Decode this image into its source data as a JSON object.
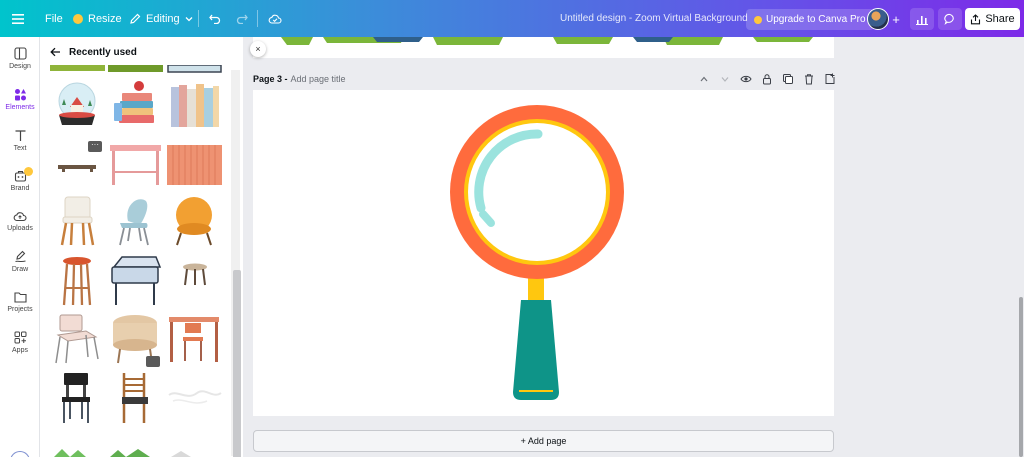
{
  "topbar": {
    "file_label": "File",
    "resize_label": "Resize",
    "editing_label": "Editing",
    "doc_title": "Untitled design - Zoom Virtual Background",
    "upgrade_label": "Upgrade to Canva Pro",
    "share_label": "Share",
    "add_member": "+"
  },
  "rail": {
    "items": [
      {
        "label": "Design",
        "icon": "design-icon"
      },
      {
        "label": "Elements",
        "icon": "elements-icon"
      },
      {
        "label": "Text",
        "icon": "text-icon"
      },
      {
        "label": "Brand",
        "icon": "brand-icon"
      },
      {
        "label": "Uploads",
        "icon": "uploads-icon"
      },
      {
        "label": "Draw",
        "icon": "draw-icon"
      },
      {
        "label": "Projects",
        "icon": "projects-icon"
      },
      {
        "label": "Apps",
        "icon": "apps-icon"
      }
    ]
  },
  "panel": {
    "title": "Recently used",
    "more_badge": "···"
  },
  "canvas": {
    "page_number": "Page 3 -",
    "page_title_placeholder": "Add page title",
    "close_glyph": "×",
    "add_page_label": "+ Add page"
  },
  "colors": {
    "accent": "#7d2ae8",
    "magnifier_ring": "#ff6b3d",
    "magnifier_inner_ring": "#ffc70f",
    "magnifier_handle": "#0e9488",
    "magnifier_glint": "#9be3de"
  }
}
